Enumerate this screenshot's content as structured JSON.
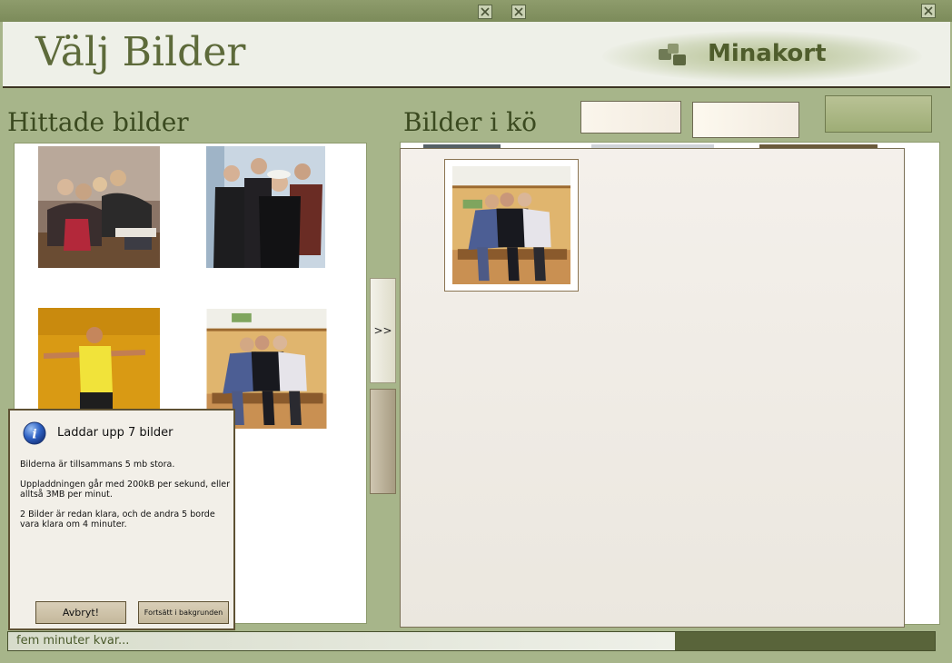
{
  "window": {
    "control_icons": [
      "close-x-icon",
      "close-x-icon",
      "close-x-icon"
    ]
  },
  "header": {
    "title": "Välj Bilder",
    "brand": "Minakort"
  },
  "found": {
    "title": "Hittade bilder",
    "images": [
      {
        "name": "group-of-friends-photo"
      },
      {
        "name": "band-photo"
      },
      {
        "name": "man-in-yellow-shirt-photo"
      },
      {
        "name": "friends-on-bench-photo"
      }
    ]
  },
  "queue": {
    "title": "Bilder i kö",
    "images": [
      {
        "name": "friends-on-bench-photo"
      }
    ]
  },
  "move_button": {
    "label": ">>"
  },
  "dialog": {
    "title": "Laddar upp 7 bilder",
    "line_1": "Bilderna är tillsammans 5 mb stora.",
    "line_2": "Uppladdningen går med 200kB per sekund, eller alltså 3MB per minut.",
    "line_3": "2 Bilder är redan klara, och de andra 5 borde vara klara om 4 minuter.",
    "cancel_label": "Avbryt!",
    "background_label": "Fortsätt i bakgrunden"
  },
  "status": {
    "text": "fem minuter kvar...",
    "progress": 0.72
  },
  "colors": {
    "background": "#a7b58a",
    "header": "#eef0e8",
    "title": "#5d6a3a",
    "accent_dark": "#59643a"
  }
}
